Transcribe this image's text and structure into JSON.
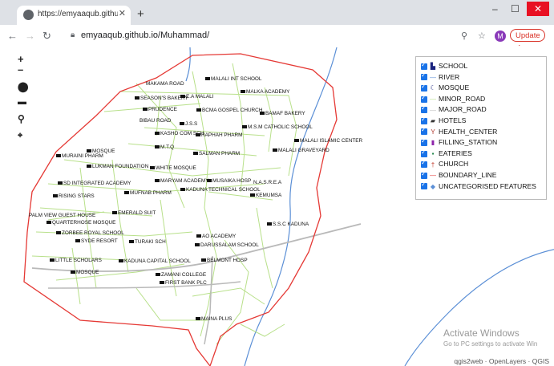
{
  "browser": {
    "tab_title": "https://emyaaqub.github.io/Mu",
    "tab_close": "✕",
    "new_tab": "+",
    "minimize": "–",
    "maximize": "☐",
    "close": "✕",
    "url": "emyaaqub.github.io/Muhammad/",
    "update_label": "Update",
    "avatar_letter": "M"
  },
  "map_controls": [
    "+",
    "–"
  ],
  "labels": [
    "MALALI INT SCHOOL",
    "MAKAMA ROAD",
    "MALKA ACADEMY",
    "SEASON'S BAKERY",
    "E.A MALALI",
    "PRUDENCE",
    "BCMA GOSPEL CHURCH",
    "BAMAF BAKERY",
    "BIBAU ROAD",
    "J.S.S",
    "M.S.M CATHOLIC SCHOOL",
    "KASHO COM SCH",
    "RAPHAH PHARM",
    "MALALI ISLAMIC CENTER",
    "M.T.Q",
    "MALALI GRAVEYARD",
    "MURAINI PHARM",
    "MOSQUE",
    "SALMAN PHARM",
    "LUKMAN FOUNDATION",
    "WHITE MOSQUE",
    "MARYAM ACADEMY",
    "MUSAIKA HOSP",
    "N.A.S.R.E.A",
    "KADUNA TECHNICAL SCHOOL",
    "SD INTEGRATED ACADEMY",
    "MUFNAB PHARM",
    "KEMUMSA",
    "RISING STARS",
    "EMERALD SUIT",
    "PALM VIEW GUEST HOUSE",
    "QUARTERHOSE MOSQUE",
    "S.S.C KADUNA",
    "ZORBEE ROYAL SCHOOL",
    "SYDE RESORT",
    "TURAKI SCH",
    "AO ACADEMY",
    "DARUSSALAM SCHOOL",
    "LITTLE SCHOLARS",
    "KADUNA CAPITAL SCHOOL",
    "BELMONT HOSP",
    "MOSQUE",
    "ZAMANI COLLEGE",
    "FIRST BANK PLC",
    "MAINA PLUS"
  ],
  "legend": [
    {
      "label": "SCHOOL",
      "icon": "school-icon",
      "color": "#1a237e"
    },
    {
      "label": "RIVER",
      "icon": "river-line",
      "color": "#5b8fd6"
    },
    {
      "label": "MOSQUE",
      "icon": "mosque-icon",
      "color": "#1a237e"
    },
    {
      "label": "MINOR_ROAD",
      "icon": "minor-road-line",
      "color": "#b8e08a"
    },
    {
      "label": "MAJOR_ROAD",
      "icon": "major-road-line",
      "color": "#b9b9b9"
    },
    {
      "label": "HOTELS",
      "icon": "hotel-icon",
      "color": "#333333"
    },
    {
      "label": "HEALTH_CENTER",
      "icon": "health-icon",
      "color": "#b03a2e"
    },
    {
      "label": "FILLING_STATION",
      "icon": "fuel-icon",
      "color": "#8e24aa"
    },
    {
      "label": "EATERIES",
      "icon": "eatery-icon",
      "color": "#1e8449"
    },
    {
      "label": "CHURCH",
      "icon": "church-icon",
      "color": "#c0392b"
    },
    {
      "label": "BOUNDARY_LINE",
      "icon": "boundary-line",
      "color": "#e53935"
    },
    {
      "label": "UNCATEGORISED FEATURES",
      "icon": "feature-icon",
      "color": "#5b8fd6"
    }
  ],
  "watermark": {
    "line1": "Activate Windows",
    "line2": "Go to PC settings to activate Win"
  },
  "attribution": "qgis2web · OpenLayers · QGIS"
}
